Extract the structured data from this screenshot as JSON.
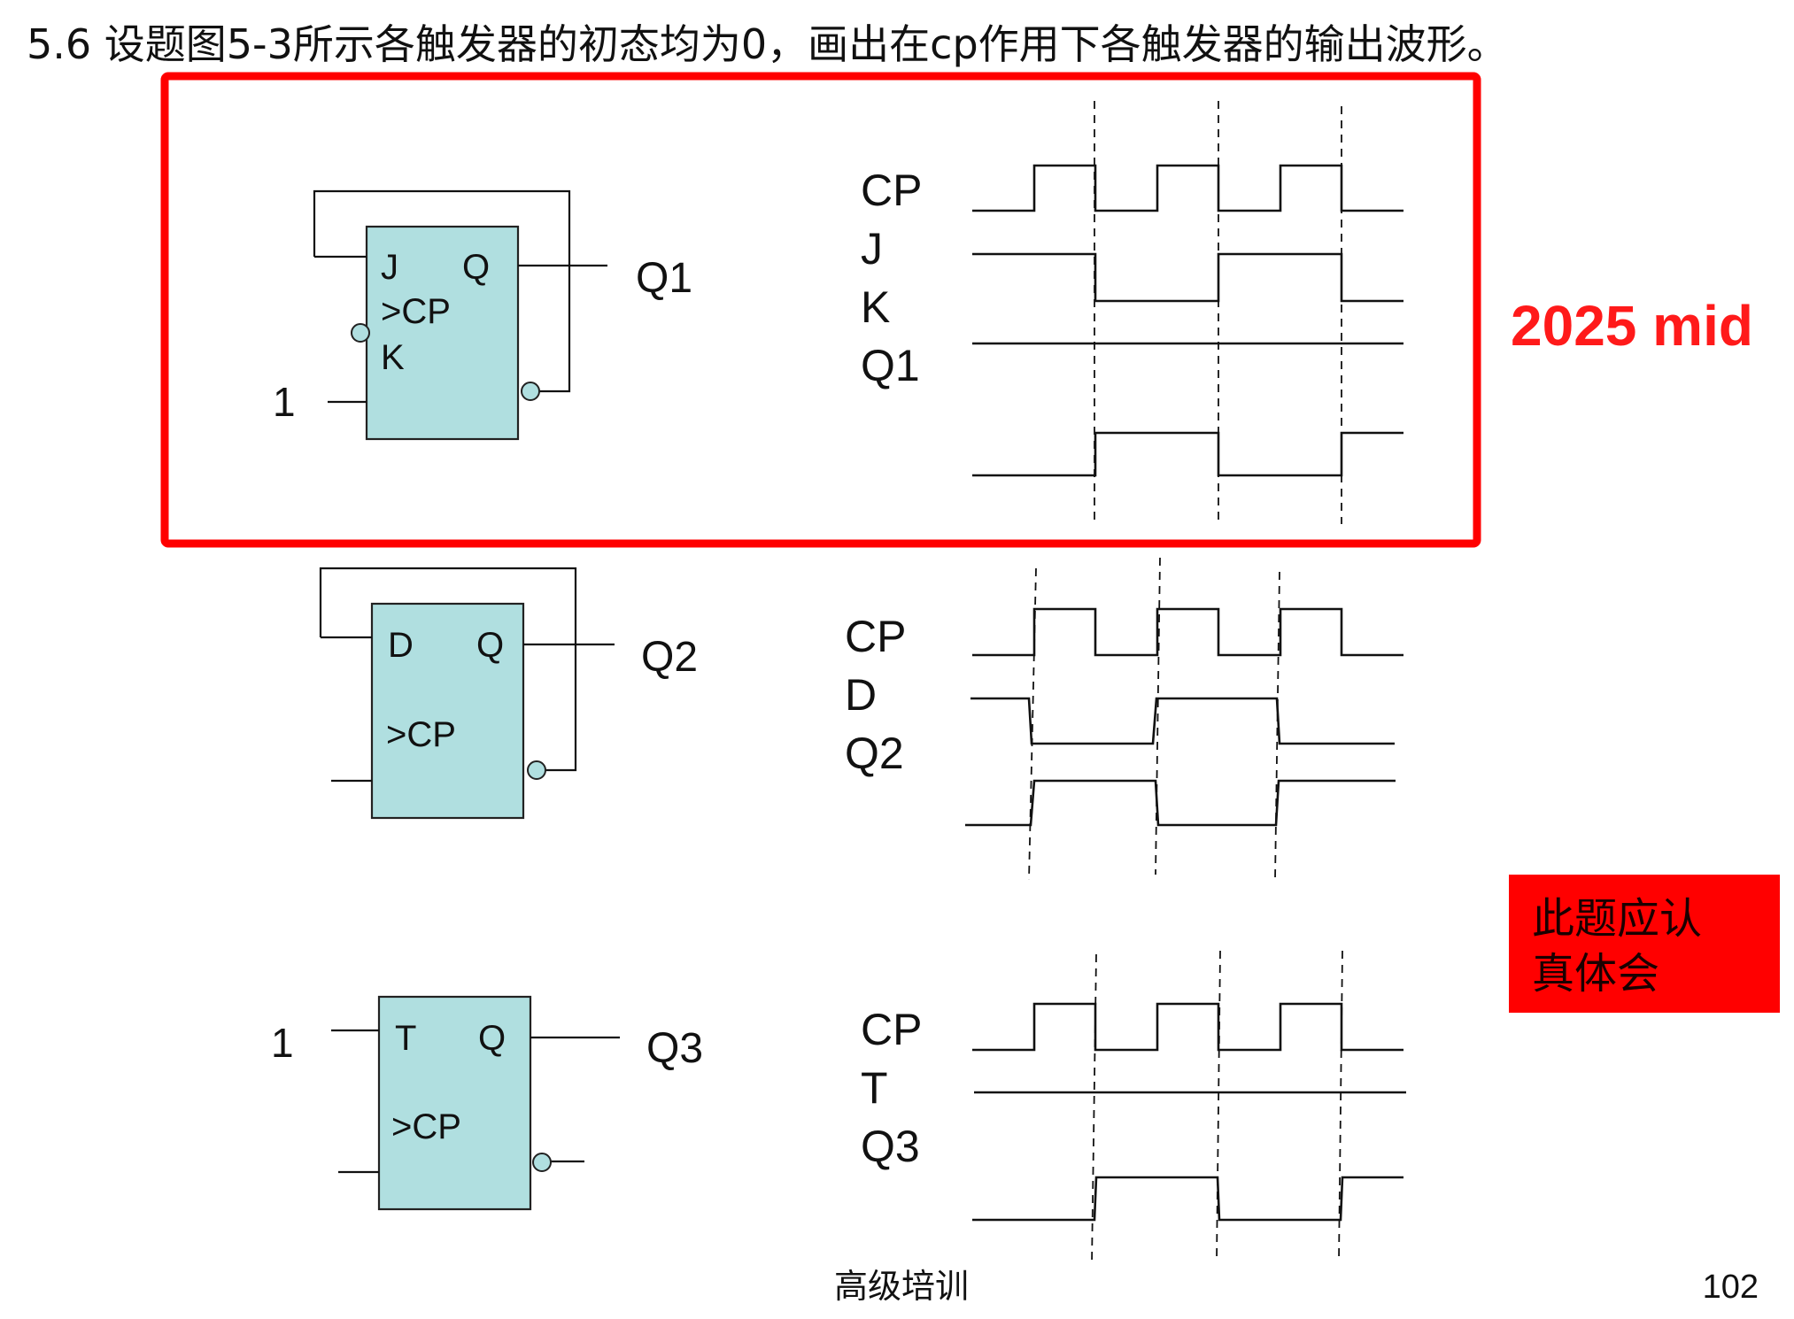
{
  "title": "5.6 设题图5-3所示各触发器的初态均为0，画出在cp作用下各触发器的输出波形。",
  "annotation_2025": "2025 mid",
  "note_lines": [
    "此题应认",
    "真体会"
  ],
  "footer": {
    "center": "高级培训",
    "page": "102"
  },
  "colors": {
    "highlight": "#ff0000",
    "flipflop_fill": "#b0dfe0",
    "note_bg": "#ff0000"
  },
  "jk": {
    "pins": {
      "j": "J",
      "q": "Q",
      "cp": ">CP",
      "k": "K"
    },
    "input_const": "1",
    "output": "Q1",
    "signals": [
      "CP",
      "J",
      "K",
      "Q1"
    ]
  },
  "d": {
    "pins": {
      "d": "D",
      "q": "Q",
      "cp": ">CP"
    },
    "output": "Q2",
    "signals": [
      "CP",
      "D",
      "Q2"
    ]
  },
  "t": {
    "pins": {
      "t": "T",
      "q": "Q",
      "cp": ">CP"
    },
    "input_const": "1",
    "output": "Q3",
    "signals": [
      "CP",
      "T",
      "Q3"
    ]
  },
  "waveforms": {
    "jk": {
      "CP": [
        0,
        1,
        0,
        1,
        0,
        1,
        0
      ],
      "J": [
        1,
        0,
        1,
        0
      ],
      "K": [
        1
      ],
      "Q1": [
        0,
        1,
        0,
        1
      ]
    },
    "d": {
      "CP": [
        0,
        1,
        0,
        1,
        0,
        1,
        0
      ],
      "D": [
        1,
        0,
        1,
        0
      ],
      "Q2": [
        0,
        1,
        0,
        1
      ]
    },
    "t": {
      "CP": [
        0,
        1,
        0,
        1,
        0,
        1,
        0
      ],
      "T": [
        1
      ],
      "Q3": [
        0,
        1,
        0,
        1
      ]
    }
  }
}
